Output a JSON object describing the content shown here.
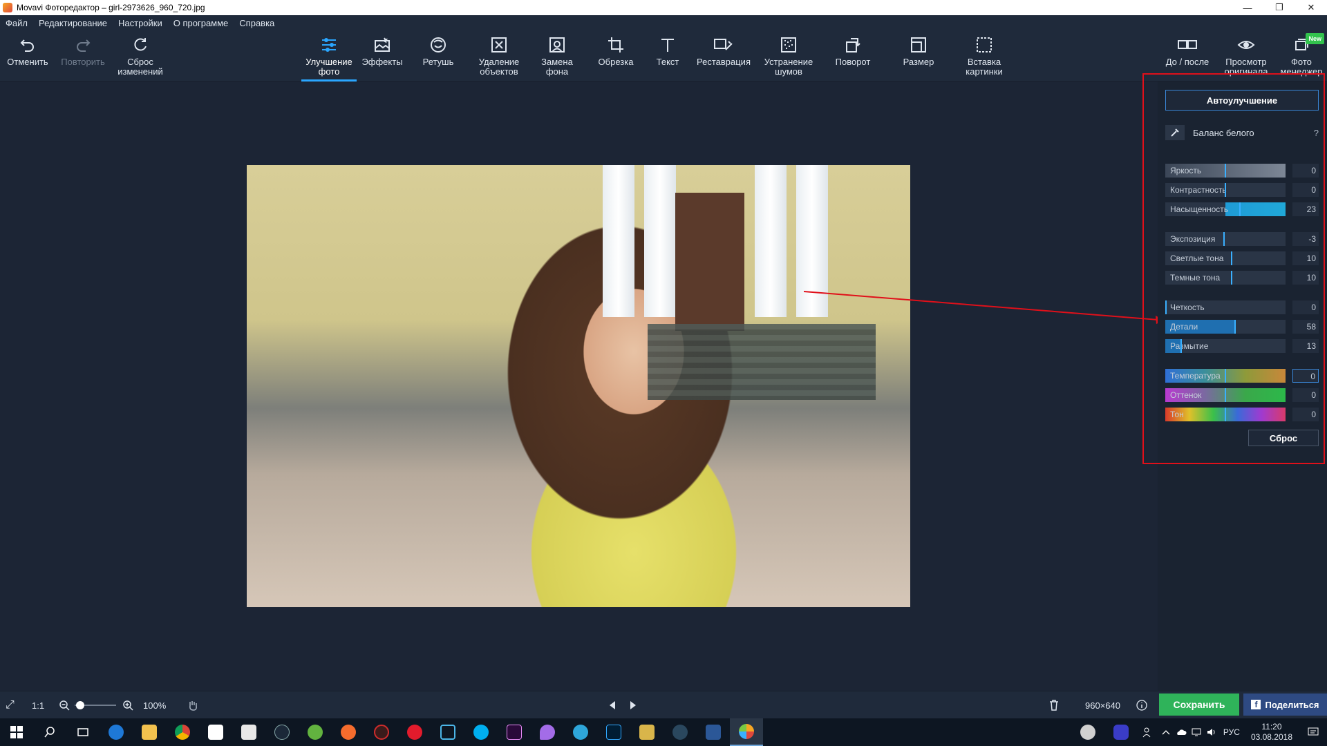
{
  "window": {
    "title": "Movavi Фоторедактор – girl-2973626_960_720.jpg",
    "controls": [
      "—",
      "❐",
      "✕"
    ]
  },
  "menu": [
    "Файл",
    "Редактирование",
    "Настройки",
    "О программе",
    "Справка"
  ],
  "toolbar": {
    "undo": "Отменить",
    "redo": "Повторить",
    "reset_changes": "Сброс\nизменений",
    "enhance": "Улучшение\nфото",
    "effects": "Эффекты",
    "retouch": "Ретушь",
    "remove_objects": "Удаление\nобъектов",
    "replace_bg": "Замена\nфона",
    "crop": "Обрезка",
    "text": "Текст",
    "restore": "Реставрация",
    "denoise": "Устранение\nшумов",
    "rotate": "Поворот",
    "resize": "Размер",
    "insert_picture": "Вставка\nкартинки",
    "before_after": "До / после",
    "view_original": "Просмотр\nоригинала",
    "photo_manager": "Фото\nменеджер",
    "new_badge": "New"
  },
  "panel": {
    "auto_enhance": "Автоулучшение",
    "white_balance": "Баланс белого",
    "help": "?",
    "reset": "Сброс",
    "sliders": [
      {
        "label": "Яркость",
        "value": "0",
        "level": 0.5
      },
      {
        "label": "Контрастность",
        "value": "0",
        "level": 0.5
      },
      {
        "label": "Насыщенность",
        "value": "23",
        "level": 0.62
      },
      {
        "label": "Экспозиция",
        "value": "-3",
        "level": 0.49
      },
      {
        "label": "Светлые тона",
        "value": "10",
        "level": 0.55
      },
      {
        "label": "Темные тона",
        "value": "10",
        "level": 0.55
      },
      {
        "label": "Четкость",
        "value": "0",
        "level": 0.0
      },
      {
        "label": "Детали",
        "value": "58",
        "level": 0.58
      },
      {
        "label": "Размытие",
        "value": "13",
        "level": 0.13
      },
      {
        "label": "Температура",
        "value": "0",
        "level": 0.5
      },
      {
        "label": "Оттенок",
        "value": "0",
        "level": 0.5
      },
      {
        "label": "Тон",
        "value": "0",
        "level": 0.5
      }
    ]
  },
  "status": {
    "fit": "⤢",
    "one_to_one": "1:1",
    "zoom": "100%",
    "image_size": "960×640",
    "save": "Сохранить",
    "share": "Поделиться"
  },
  "taskbar": {
    "lang": "РУС",
    "time": "11:20",
    "date": "03.08.2018"
  },
  "colors": {
    "accent": "#2aa6ff",
    "save_green": "#2fb35a",
    "annotation_red": "#e0101a"
  }
}
